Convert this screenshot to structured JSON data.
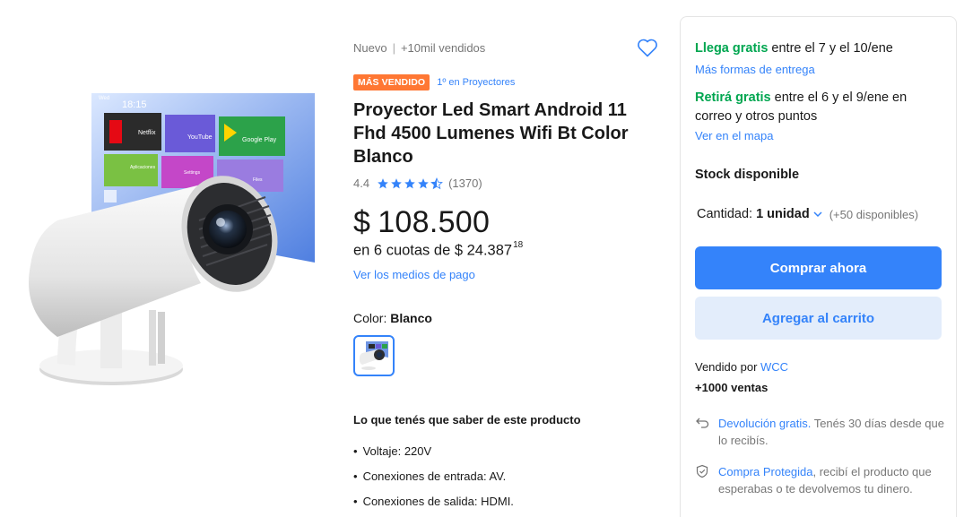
{
  "product": {
    "condition": "Nuevo",
    "sold": "+10mil vendidos",
    "badge": "MÁS VENDIDO",
    "rank": "1º en Proyectores",
    "title": "Proyector Led Smart Android 11 Fhd 4500 Lumenes Wifi Bt Color Blanco",
    "rating": "4.4",
    "stars": 4.4,
    "reviews": "(1370)",
    "price_currency": "$",
    "price": "108.500",
    "installments_text": "en 6 cuotas de $ 24.387",
    "installments_cents": "18",
    "payments_link": "Ver los medios de pago",
    "color_label": "Color: ",
    "color_value": "Blanco"
  },
  "screen_apps": {
    "date": "Wed",
    "time": "18:15",
    "netflix": "Netflix",
    "youtube": "YouTube",
    "google_play": "Google Play",
    "apps": "Aplicaciones",
    "settings": "Settings",
    "files": "Files"
  },
  "features": {
    "title": "Lo que tenés que saber de este producto",
    "items": [
      "Voltaje: 220V",
      "Conexiones de entrada: AV.",
      "Conexiones de salida: HDMI."
    ]
  },
  "buybox": {
    "ship_free": "Llega gratis",
    "ship_dates": " entre el 7 y el 10/ene",
    "more_shipping": "Más formas de entrega",
    "pickup_free": "Retirá gratis",
    "pickup_text": " entre el 6 y el 9/ene en correo y otros puntos",
    "map_link": "Ver en el mapa",
    "stock": "Stock disponible",
    "qty_label": "Cantidad:",
    "qty_value": "1 unidad",
    "qty_available": "(+50 disponibles)",
    "buy_now": "Comprar ahora",
    "add_cart": "Agregar al carrito",
    "seller_prefix": "Vendido por ",
    "seller_name": "WCC",
    "sales": "+1000 ventas",
    "return_link": "Devolución gratis.",
    "return_text": " Tenés 30 días desde que lo recibís.",
    "protect_link": "Compra Protegida",
    "protect_text": ", recibí el producto que esperabas o te devolvemos tu dinero."
  },
  "colors": {
    "accent": "#3483fa",
    "green": "#00a650",
    "badge": "#ff7733",
    "cart_bg": "rgba(65,137,230,.15)"
  }
}
